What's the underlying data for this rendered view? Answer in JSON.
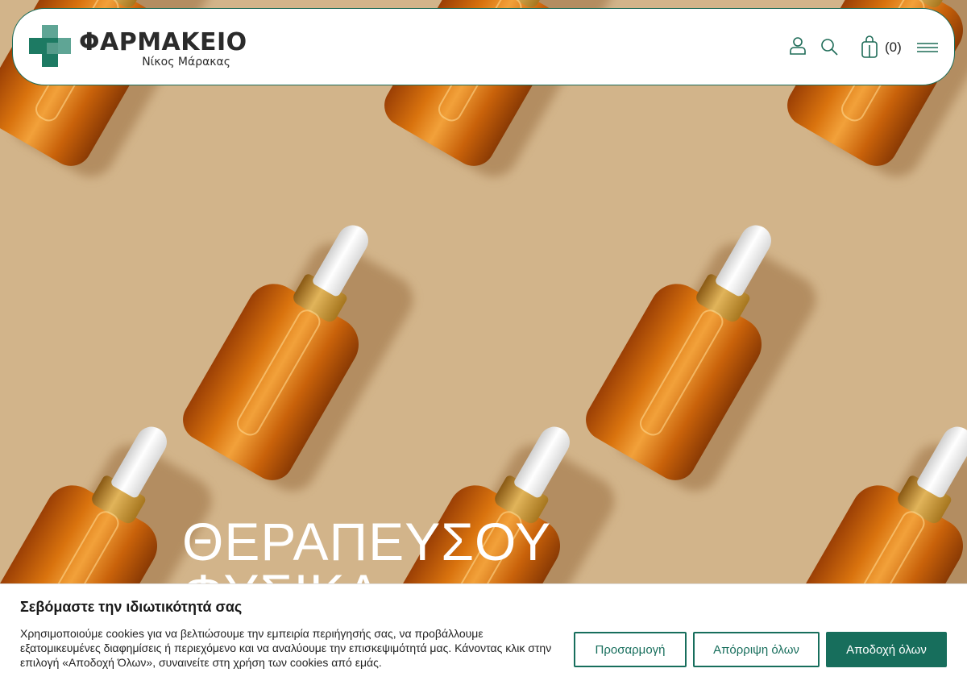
{
  "header": {
    "brand": "ΦΑΡΜΑΚΕΙΟ",
    "subtitle": "Νίκος Μάρακας",
    "cart_count": "(0)",
    "icons": [
      "user-icon",
      "search-icon",
      "shopping-bag-icon",
      "menu-icon"
    ]
  },
  "hero": {
    "title_line1": "ΘΕΡΑΠΕΥΣΟΥ",
    "title_line2": "ΦΥΣΙΚΑ"
  },
  "cookie_banner": {
    "title": "Σεβόμαστε την ιδιωτικότητά σας",
    "text": "Χρησιμοποιούμε cookies για να βελτιώσουμε την εμπειρία περιήγησής σας, να προβάλλουμε εξατομικευμένες διαφημίσεις ή περιεχόμενο και να αναλύουμε την επισκεψιμότητά μας. Κάνοντας κλικ στην επιλογή «Αποδοχή Όλων», συναινείτε στη χρήση των cookies από εμάς.",
    "customize_label": "Προσαρμογή",
    "reject_label": "Απόρριψη όλων",
    "accept_label": "Αποδοχή όλων"
  },
  "colors": {
    "accent": "#176e5c",
    "hero_background": "#d2b48a"
  }
}
